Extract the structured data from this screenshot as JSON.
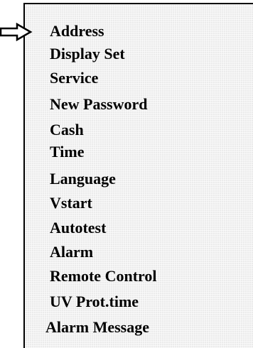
{
  "menu": {
    "selected_index": 0,
    "pointer_icon": "right-arrow-outline-icon",
    "items": [
      {
        "label": "Address"
      },
      {
        "label": "Display Set"
      },
      {
        "label": "Service"
      },
      {
        "label": "New Password"
      },
      {
        "label": "Cash"
      },
      {
        "label": "Time"
      },
      {
        "label": "Language"
      },
      {
        "label": "Vstart"
      },
      {
        "label": "Autotest"
      },
      {
        "label": "Alarm"
      },
      {
        "label": "Remote Control"
      },
      {
        "label": "UV Prot.time"
      },
      {
        "label": "Alarm Message"
      }
    ]
  }
}
